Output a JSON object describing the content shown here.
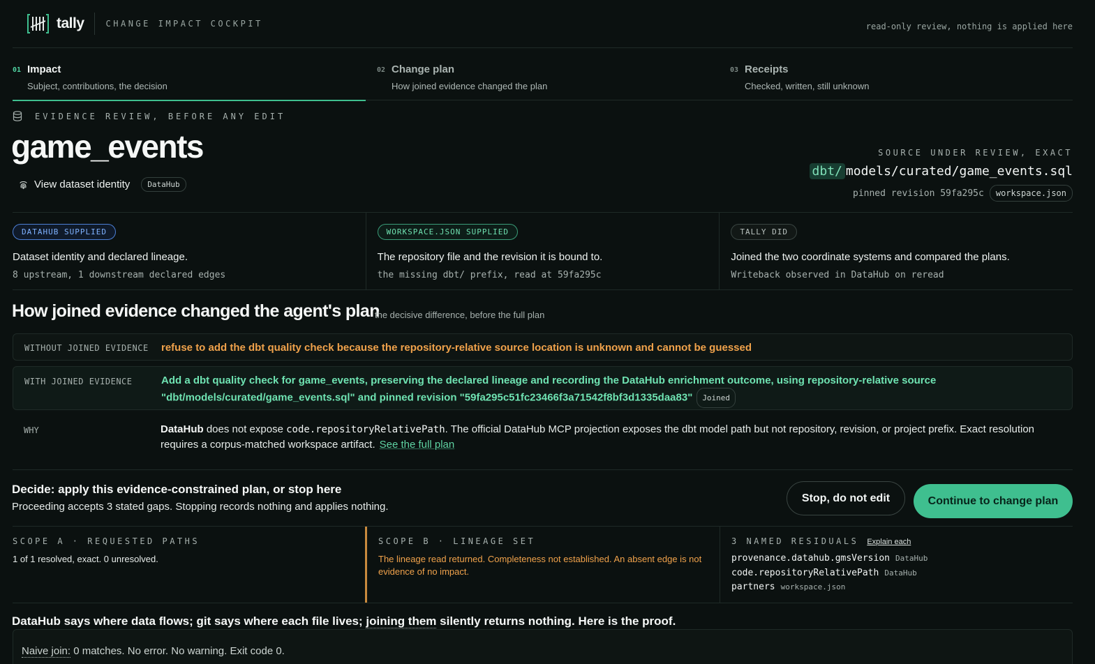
{
  "header": {
    "brand": "tally",
    "subtitle": "CHANGE IMPACT COCKPIT",
    "notice": "read-only review, nothing is applied here",
    "logo_icon": "tally-marks-icon"
  },
  "tabs": [
    {
      "num": "01",
      "title": "Impact",
      "sub": "Subject, contributions, the decision",
      "active": true
    },
    {
      "num": "02",
      "title": "Change plan",
      "sub": "How joined evidence changed the plan",
      "active": false
    },
    {
      "num": "03",
      "title": "Receipts",
      "sub": "Checked, written, still unknown",
      "active": false
    }
  ],
  "subject": {
    "eyebrow": "EVIDENCE REVIEW, BEFORE ANY EDIT",
    "title": "game_events",
    "identity_label": "View dataset identity",
    "identity_pill": "DataHub",
    "source_eyebrow": "SOURCE UNDER REVIEW, EXACT",
    "source_prefix": "dbt/",
    "source_path": "models/curated/game_events.sql",
    "pinned_text": "pinned revision 59fa295c",
    "pinned_pill": "workspace.json"
  },
  "supplied": [
    {
      "badge": "DATAHUB SUPPLIED",
      "desc": "Dataset identity and declared lineage.",
      "meta": "8 upstream, 1 downstream declared edges",
      "color": "#7fb2ff"
    },
    {
      "badge": "WORKSPACE.JSON SUPPLIED",
      "desc": "The repository file and the revision it is bound to.",
      "meta": "the missing dbt/ prefix, read at 59fa295c",
      "color": "#6fe0b0"
    },
    {
      "badge": "TALLY DID",
      "desc": "Joined the two coordinate systems and compared the plans.",
      "meta": "Writeback observed in DataHub on reread",
      "color": "#b9c2bf"
    }
  ],
  "plan": {
    "title": "How joined evidence changed the agent's plan",
    "subtitle": "the decisive difference, before the full plan",
    "without_key": "WITHOUT JOINED EVIDENCE",
    "without_val": "refuse to add the dbt quality check because the repository-relative source location is unknown and cannot be guessed",
    "with_key": "WITH JOINED EVIDENCE",
    "with_val": "Add a dbt quality check for game_events, preserving the declared lineage and recording the DataHub enrichment outcome, using repository-relative source \"dbt/models/curated/game_events.sql\" and pinned revision \"59fa295c51fc23466f3a71542f8bf3d1335daa83\"",
    "with_pill": "Joined",
    "why_key": "WHY",
    "why_bold": "DataHub",
    "why_text1": " does not expose ",
    "why_code": "code.repositoryRelativePath",
    "why_text2": ". The official DataHub MCP projection exposes the dbt model path but not repository, revision, or project prefix. Exact resolution requires a corpus-matched workspace artifact.",
    "why_link": "See the full plan",
    "without_color": "#f0a24b",
    "with_color": "#6fe3b2"
  },
  "decide": {
    "title": "Decide: apply this evidence-constrained plan, or stop here",
    "sub": "Proceeding accepts 3 stated gaps. Stopping records nothing and applies nothing.",
    "stop_label": "Stop, do not edit",
    "continue_label": "Continue to change plan",
    "accent": "#3fbf8f"
  },
  "scopes": {
    "a_head": "SCOPE A · REQUESTED PATHS",
    "a_body": "1 of 1 resolved, exact. 0 unresolved.",
    "b_head": "SCOPE B · LINEAGE SET",
    "b_body": "The lineage read returned. Completeness not established. An absent edge is not evidence of no impact.",
    "c_head": "3 NAMED RESIDUALS",
    "c_link": "Explain each",
    "residuals": [
      {
        "name": "provenance.datahub.gmsVersion",
        "src": "DataHub"
      },
      {
        "name": "code.repositoryRelativePath",
        "src": "DataHub"
      },
      {
        "name": "partners",
        "src": "workspace.json"
      }
    ]
  },
  "proof": {
    "pre": "DataHub says where data flows; git says where each file lives; ",
    "dotted": "joining them",
    "post": " silently returns nothing. Here is the proof.",
    "naive_label": "Naive join:",
    "naive_text": " 0 matches. No error. No warning. Exit code 0."
  }
}
